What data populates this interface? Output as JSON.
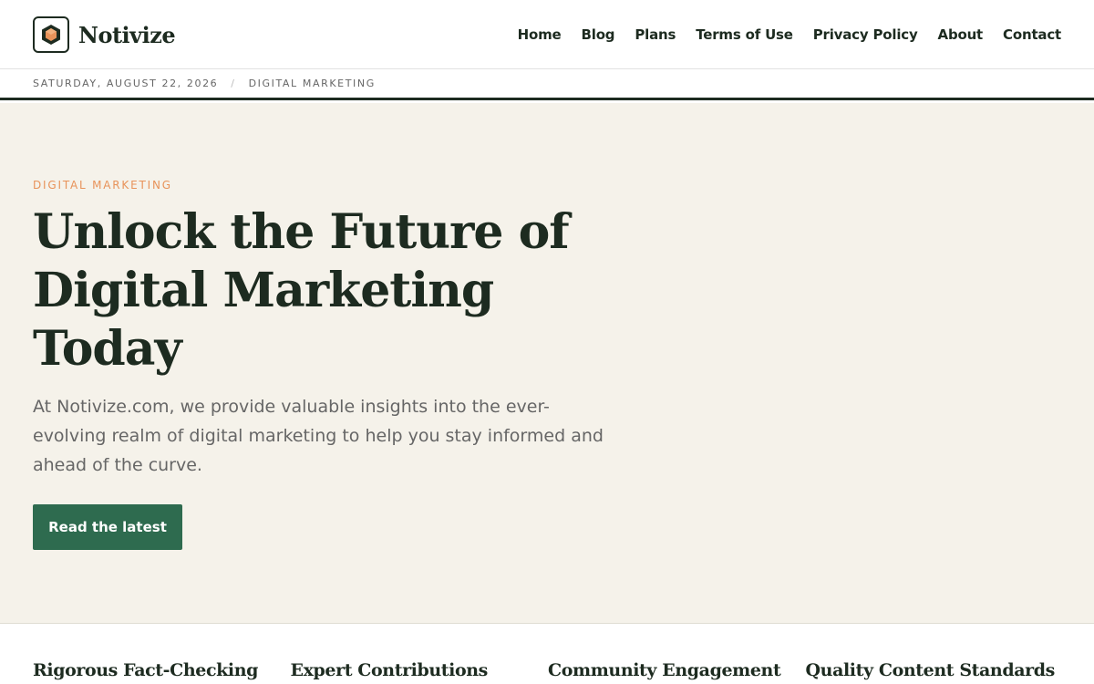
{
  "brand": {
    "name": "Notivize",
    "logo_icon": "hexagon-logo-icon",
    "accent": "#e8935a"
  },
  "nav": {
    "items": [
      {
        "label": "Home"
      },
      {
        "label": "Blog"
      },
      {
        "label": "Plans"
      },
      {
        "label": "Terms of Use"
      },
      {
        "label": "Privacy Policy"
      },
      {
        "label": "About"
      },
      {
        "label": "Contact"
      }
    ]
  },
  "meta": {
    "date": "SATURDAY, AUGUST 22, 2026",
    "separator": "/",
    "category": "DIGITAL MARKETING"
  },
  "hero": {
    "kicker": "DIGITAL MARKETING",
    "title": "Unlock the Future of Digital Marketing Today",
    "text": "At Notivize.com, we provide valuable insights into the ever-evolving realm of digital marketing to help you stay informed and ahead of the curve.",
    "cta_label": "Read the latest",
    "background": "#f5f2ea",
    "cta_color": "#2e6b4f"
  },
  "features": [
    {
      "title": "Rigorous Fact-Checking"
    },
    {
      "title": "Expert Contributions"
    },
    {
      "title": "Community Engagement"
    },
    {
      "title": "Quality Content Standards"
    }
  ]
}
